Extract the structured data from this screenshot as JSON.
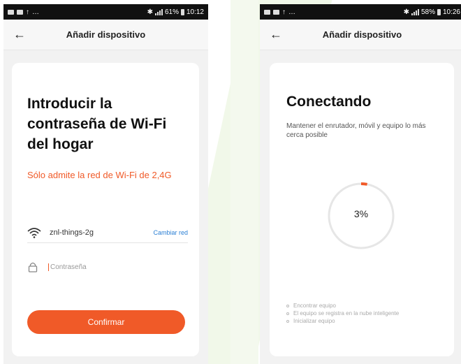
{
  "colors": {
    "accent": "#f05a28",
    "link": "#2a7fd4",
    "background_shape": "#eef6e4"
  },
  "left_screen": {
    "status_bar": {
      "signal_text": "61%",
      "time": "10:12"
    },
    "app_bar": {
      "back_icon": "arrow-left-icon",
      "title": "Añadir dispositivo"
    },
    "card": {
      "title": "Introducir la contraseña de Wi-Fi del hogar",
      "warning": "Sólo admite la red de Wi-Fi de 2,4G",
      "wifi": {
        "icon": "wifi-icon",
        "network_name": "znl-things-2g",
        "change_link": "Cambiar red"
      },
      "password": {
        "icon": "lock-icon",
        "placeholder": "Contraseña",
        "value": ""
      },
      "confirm_button": "Confirmar"
    }
  },
  "right_screen": {
    "status_bar": {
      "signal_text": "58%",
      "time": "10:26"
    },
    "app_bar": {
      "back_icon": "arrow-left-icon",
      "title": "Añadir dispositivo"
    },
    "card": {
      "title": "Conectando",
      "subtitle": "Mantener el enrutador, móvil y equipo lo más cerca posible",
      "progress": {
        "value": 3,
        "label": "3%"
      },
      "steps": [
        "Encontrar equipo",
        "El equipo se registra en la nube inteligente",
        "Inicializar equipo"
      ]
    }
  }
}
